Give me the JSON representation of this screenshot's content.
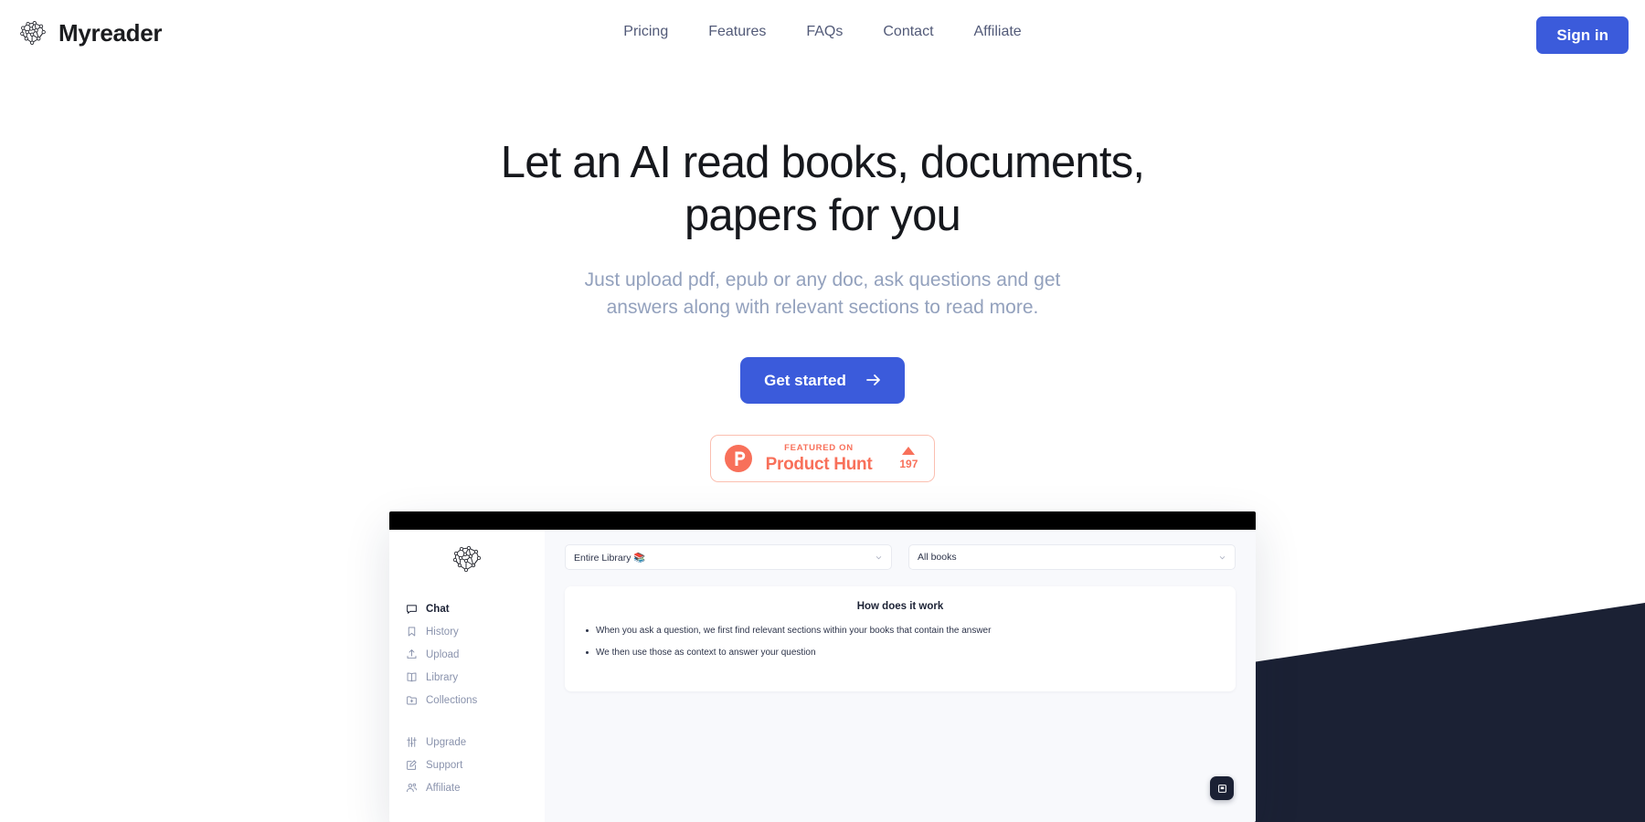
{
  "brand": {
    "name": "Myreader",
    "logo_icon": "network-graph-icon"
  },
  "nav": {
    "items": [
      {
        "label": "Pricing"
      },
      {
        "label": "Features"
      },
      {
        "label": "FAQs"
      },
      {
        "label": "Contact"
      },
      {
        "label": "Affiliate"
      }
    ],
    "signin_label": "Sign in"
  },
  "hero": {
    "title": "Let an AI read books, documents, papers for you",
    "subtitle": "Just upload pdf, epub or any doc, ask questions and get answers along with relevant sections to read more.",
    "cta_label": "Get started",
    "cta_icon": "arrow-right-icon"
  },
  "product_hunt": {
    "featured_label": "FEATURED ON",
    "name": "Product Hunt",
    "upvote_icon": "triangle-up-icon",
    "votes": "197",
    "logo_icon": "product-hunt-icon",
    "color": "#f8705a"
  },
  "app": {
    "sidebar": {
      "logo_icon": "network-graph-icon",
      "primary_items": [
        {
          "label": "Chat",
          "icon": "message-square-icon",
          "active": true
        },
        {
          "label": "History",
          "icon": "bookmark-icon",
          "active": false
        },
        {
          "label": "Upload",
          "icon": "upload-icon",
          "active": false
        },
        {
          "label": "Library",
          "icon": "open-book-icon",
          "active": false
        },
        {
          "label": "Collections",
          "icon": "folder-plus-icon",
          "active": false
        }
      ],
      "secondary_items": [
        {
          "label": "Upgrade",
          "icon": "sliders-icon"
        },
        {
          "label": "Support",
          "icon": "edit-square-icon"
        },
        {
          "label": "Affiliate",
          "icon": "users-icon"
        }
      ]
    },
    "filters": {
      "library_select": "Entire Library 📚",
      "books_select": "All books"
    },
    "card": {
      "title": "How does it work",
      "bullets": [
        "When you ask a question, we first find relevant sections within your books that contain the answer",
        "We then use those as context to answer your question"
      ]
    },
    "fab_icon": "book-square-icon"
  },
  "colors": {
    "accent_blue": "#3b5bdb",
    "dark_navy": "#1b2134",
    "nav_text": "#525a78",
    "subtitle": "#93a1bd"
  }
}
